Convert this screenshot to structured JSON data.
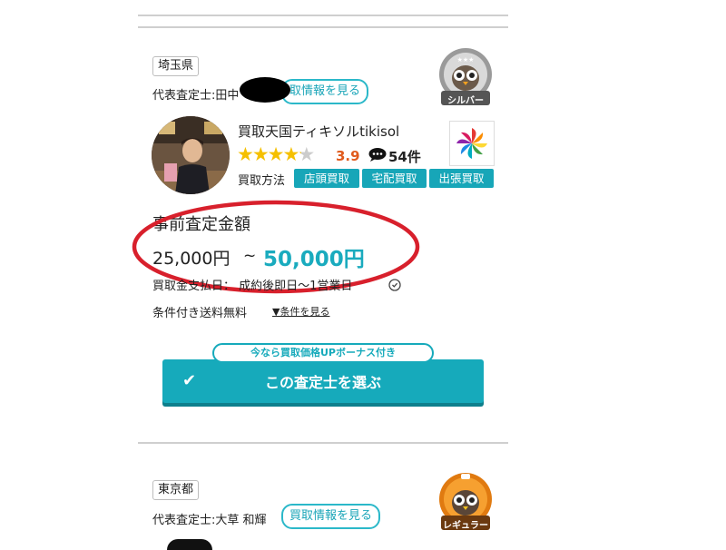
{
  "card1": {
    "prefecture": "埼玉県",
    "appraiser_label": "代表査定士:田中",
    "buyback_info_link": "取情報を見る",
    "rank_badge": "シルバー",
    "shop_name": "買取天国ティキソルtikisol",
    "rating": "3.9",
    "rating_value": 3.9,
    "review_count": "54件",
    "methods_label": "買取方法",
    "methods": [
      "店頭買取",
      "宅配買取",
      "出張買取"
    ],
    "estimate_title": "事前査定金額",
    "estimate_low": "25,000円",
    "estimate_tilde": "~",
    "estimate_high": "50,000円",
    "payment_line": "買取金支払日： 成約後即日〜1営業日",
    "shipping_text": "条件付き送料無料",
    "conditions_link": "▼条件を見る",
    "bonus_label": "今なら買取価格UPボーナス付き",
    "select_button": "この査定士を選ぶ",
    "select_check": "✔"
  },
  "card2": {
    "prefecture": "東京都",
    "appraiser_label": "代表査定士:大草 和輝",
    "buyback_info_link": "買取情報を見る",
    "rank_badge": "レギュラー"
  },
  "colors": {
    "accent": "#16aabb",
    "rating": "#e05a1c",
    "star": "#f5c000",
    "annotation_red": "#d8202c"
  }
}
